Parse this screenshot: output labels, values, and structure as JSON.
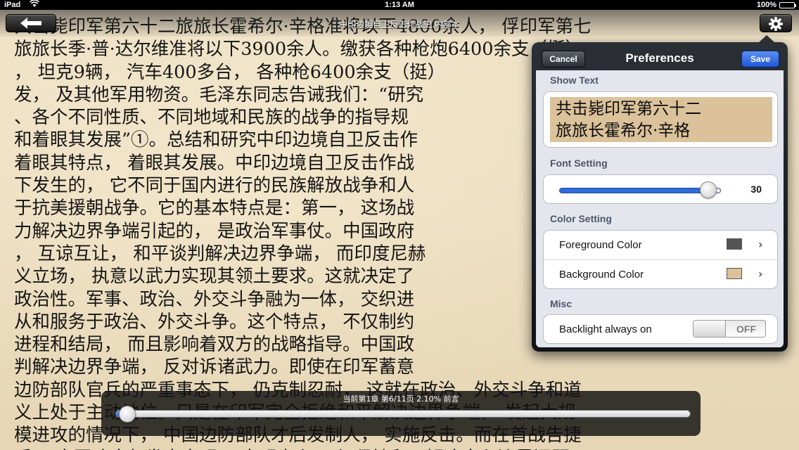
{
  "status_bar": {
    "carrier": "iPad",
    "time": "1:13 AM",
    "battery": "100%"
  },
  "header": {
    "title": "中印边境自卫反击作战史.内部本",
    "back_icon": "arrow-left-icon",
    "settings_icon": "gear-icon"
  },
  "reader": {
    "lines": [
      "共击毙印军第六十二旅旅长霍希尔·辛格准将以下4800余人， 俘印军第七",
      "旅旅长季·普·达尔维准将以下3900余人。缴获各种枪炮6400余支（挺）",
      "， 坦克9辆， 汽车400多台， 各种枪6400余支（挺）",
      "发， 及其他军用物资。毛泽东同志告诫我们：“研究",
      "、各个不同性质、不同地域和民族的战争的指导规",
      "和着眼其发展”①。总结和研究中印边境自卫反击作",
      "着眼其特点， 着眼其发展。中印边境自卫反击作战",
      "下发生的， 它不同于国内进行的民族解放战争和人",
      "于抗美援朝战争。它的基本特点是：第一， 这场战",
      "力解决边界争端引起的， 是政治军事仗。中国政府",
      "， 互谅互让， 和平谈判解决边界争端， 而印度尼赫",
      "义立场， 执意以武力实现其领土要求。这就决定了",
      "政治性。军事、政治、外交斗争融为一体， 交织进",
      "从和服务于政治、外交斗争。这个特点， 不仅制约",
      "进程和结局， 而且影响着双方的战略指导。中国政",
      "判解决边界争端， 反对诉诸武力。即使在印军蓄意",
      "边防部队官兵的严重事态下， 仍克制忍耐， 这就在政治、外交斗争和道",
      "义上处于主动地位。只是在印军完全拒绝和平解决边界争端， 发起大规",
      "模进攻的情况下， 中国边防部队才后发制人， 实施反击。而在首战告捷",
      "后， 中国政府却发表声明， 申明大义， 仍坚持和平解决中印边界问题。"
    ]
  },
  "preferences": {
    "title": "Preferences",
    "cancel_label": "Cancel",
    "save_label": "Save",
    "show_text_label": "Show Text",
    "preview_line1": "共击毙印军第六十二",
    "preview_line2": "旅旅长霍希尔·辛格",
    "font_setting_label": "Font Setting",
    "font_size": "30",
    "font_size_slider_fraction": 0.92,
    "color_setting_label": "Color Setting",
    "foreground_label": "Foreground Color",
    "foreground_color": "#555555",
    "background_label": "Background Color",
    "background_color": "#dcc29a",
    "misc_label": "Misc",
    "backlight_label": "Backlight always on",
    "backlight_state": "OFF"
  },
  "progress": {
    "label": "当前第1章 第6/11页 2.10% 前言",
    "fraction": 0.021
  }
}
